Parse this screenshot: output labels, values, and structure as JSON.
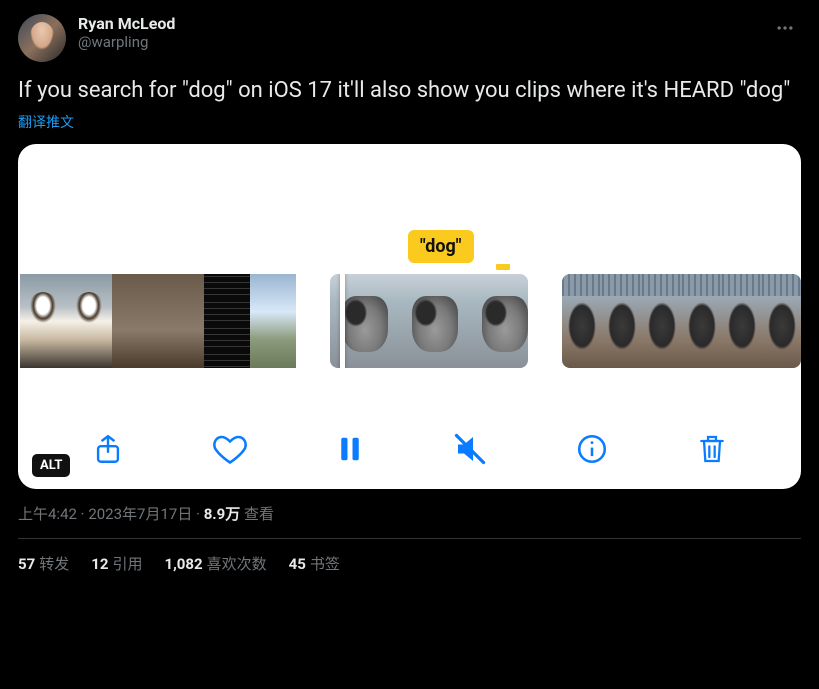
{
  "author": {
    "display_name": "Ryan McLeod",
    "handle": "@warpling"
  },
  "tweet_text": "If you search for \"dog\" on iOS 17 it'll also show you clips where it's HEARD \"dog\"",
  "translate_label": "翻译推文",
  "media": {
    "highlight_label": "\"dog\"",
    "alt_badge": "ALT"
  },
  "meta": {
    "time": "上午4:42",
    "separator": " · ",
    "date": "2023年7月17日",
    "views_number": "8.9万",
    "views_label": " 查看"
  },
  "stats": {
    "retweets_num": "57",
    "retweets_label": "转发",
    "quotes_num": "12",
    "quotes_label": "引用",
    "likes_num": "1,082",
    "likes_label": "喜欢次数",
    "bookmarks_num": "45",
    "bookmarks_label": "书签"
  }
}
